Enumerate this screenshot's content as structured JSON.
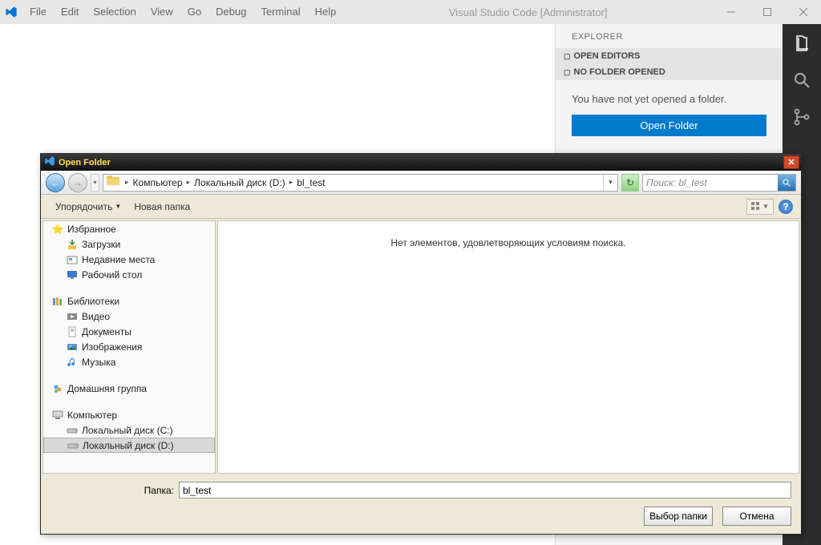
{
  "titlebar": {
    "title": "Visual Studio Code [Administrator]",
    "menu": [
      "File",
      "Edit",
      "Selection",
      "View",
      "Go",
      "Debug",
      "Terminal",
      "Help"
    ]
  },
  "explorer": {
    "title": "EXPLORER",
    "section1": "OPEN EDITORS",
    "section2": "NO FOLDER OPENED",
    "hint": "You have not yet opened a folder.",
    "open_btn": "Open Folder"
  },
  "dialog": {
    "title": "Open Folder",
    "breadcrumb": {
      "seg0": "Компьютер",
      "seg1": "Локальный диск (D:)",
      "seg2": "bl_test"
    },
    "search_placeholder": "Поиск: bl_test",
    "toolbar": {
      "organize": "Упорядочить",
      "newfolder": "Новая папка"
    },
    "tree": {
      "fav": "Избранное",
      "fav_items": {
        "downloads": "Загрузки",
        "recent": "Недавние места",
        "desktop": "Рабочий стол"
      },
      "lib": "Библиотеки",
      "lib_items": {
        "video": "Видео",
        "docs": "Документы",
        "images": "Изображения",
        "music": "Музыка"
      },
      "homegroup": "Домашняя группа",
      "computer": "Компьютер",
      "comp_items": {
        "c": "Локальный диск (C:)",
        "d": "Локальный диск (D:)"
      }
    },
    "empty_msg": "Нет элементов, удовлетворяющих условиям поиска.",
    "folder_label": "Папка:",
    "folder_value": "bl_test",
    "btn_select": "Выбор папки",
    "btn_cancel": "Отмена"
  }
}
